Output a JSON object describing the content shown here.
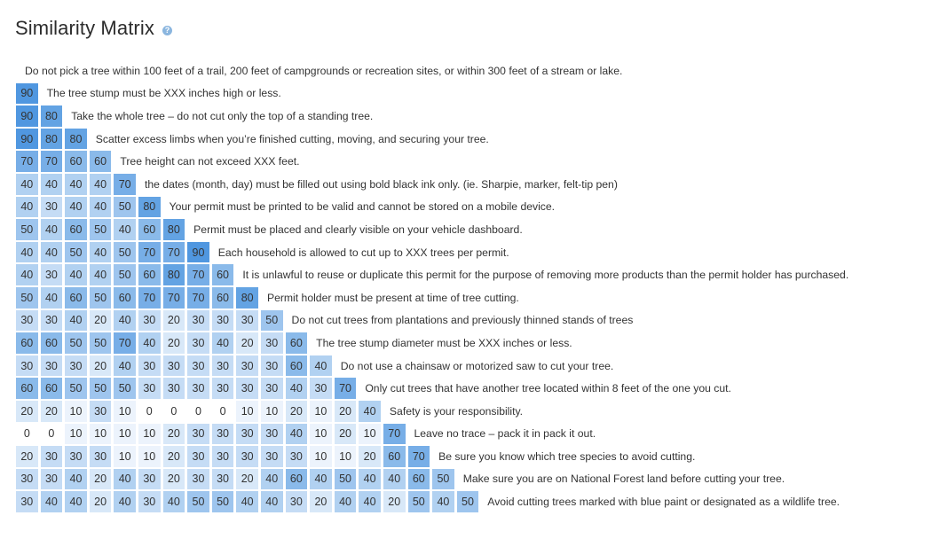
{
  "header": {
    "title": "Similarity Matrix",
    "help_icon": "question-circle-icon"
  },
  "colors": {
    "scale_min": "#ffffff",
    "scale_max": "#5097e0"
  },
  "rows": [
    {
      "label": "Do not pick a tree within 100 feet of a trail, 200 feet of campgrounds or recreation sites, or within 300 feet of a stream or lake.",
      "values": []
    },
    {
      "label": "The tree stump must be XXX inches high or less.",
      "values": [
        90
      ]
    },
    {
      "label": "Take the whole tree – do not cut only the top of a standing tree.",
      "values": [
        90,
        80
      ]
    },
    {
      "label": "Scatter excess limbs when you’re finished cutting, moving, and securing your tree.",
      "values": [
        90,
        80,
        80
      ]
    },
    {
      "label": "Tree height can not exceed XXX feet.",
      "values": [
        70,
        70,
        60,
        60
      ]
    },
    {
      "label": "the dates (month, day) must be filled out using bold black ink only. (ie. Sharpie, marker, felt-tip pen)",
      "values": [
        40,
        40,
        40,
        40,
        70
      ]
    },
    {
      "label": "Your permit must be printed to be valid and cannot be stored on a mobile device.",
      "values": [
        40,
        30,
        40,
        40,
        50,
        80
      ]
    },
    {
      "label": "Permit must be placed and clearly visible on your vehicle dashboard.",
      "values": [
        50,
        40,
        60,
        50,
        40,
        60,
        80
      ]
    },
    {
      "label": "Each household is allowed to cut up to XXX trees per permit.",
      "values": [
        40,
        40,
        50,
        40,
        50,
        70,
        70,
        90
      ]
    },
    {
      "label": "It is unlawful to reuse or duplicate this permit for the purpose of removing more products than the permit holder has purchased.",
      "values": [
        40,
        30,
        40,
        40,
        50,
        60,
        80,
        70,
        60
      ]
    },
    {
      "label": "Permit holder must be present at time of tree cutting.",
      "values": [
        50,
        40,
        60,
        50,
        60,
        70,
        70,
        70,
        60,
        80
      ]
    },
    {
      "label": "Do not cut trees from plantations and previously thinned stands of trees",
      "values": [
        30,
        30,
        40,
        20,
        40,
        30,
        20,
        30,
        30,
        30,
        50
      ]
    },
    {
      "label": "The tree stump diameter must be XXX inches or less.",
      "values": [
        60,
        60,
        50,
        50,
        70,
        40,
        20,
        30,
        40,
        20,
        30,
        60
      ]
    },
    {
      "label": "Do not use a chainsaw or motorized saw to cut your tree.",
      "values": [
        30,
        30,
        30,
        20,
        40,
        30,
        30,
        30,
        30,
        30,
        30,
        60,
        40
      ]
    },
    {
      "label": "Only cut trees that have another tree located within 8 feet of the one you cut.",
      "values": [
        60,
        60,
        50,
        50,
        50,
        30,
        30,
        30,
        30,
        30,
        30,
        40,
        30,
        70
      ]
    },
    {
      "label": "Safety is your responsibility.",
      "values": [
        20,
        20,
        10,
        30,
        10,
        0,
        0,
        0,
        0,
        10,
        10,
        20,
        10,
        20,
        40
      ]
    },
    {
      "label": "Leave no trace – pack it in pack it out.",
      "values": [
        0,
        0,
        10,
        10,
        10,
        10,
        20,
        30,
        30,
        30,
        30,
        40,
        10,
        20,
        10,
        70
      ]
    },
    {
      "label": "Be sure you know which tree species to avoid cutting.",
      "values": [
        20,
        30,
        30,
        30,
        10,
        10,
        20,
        30,
        30,
        30,
        30,
        30,
        10,
        10,
        20,
        60,
        70
      ]
    },
    {
      "label": "Make sure you are on National Forest land before cutting your tree.",
      "values": [
        30,
        30,
        40,
        20,
        40,
        30,
        20,
        30,
        30,
        20,
        40,
        60,
        40,
        50,
        40,
        40,
        60,
        50
      ]
    },
    {
      "label": "Avoid cutting trees marked with blue paint or designated as a wildlife tree.",
      "values": [
        30,
        40,
        40,
        20,
        40,
        30,
        40,
        50,
        50,
        40,
        40,
        30,
        20,
        40,
        40,
        20,
        50,
        40,
        50
      ]
    }
  ]
}
